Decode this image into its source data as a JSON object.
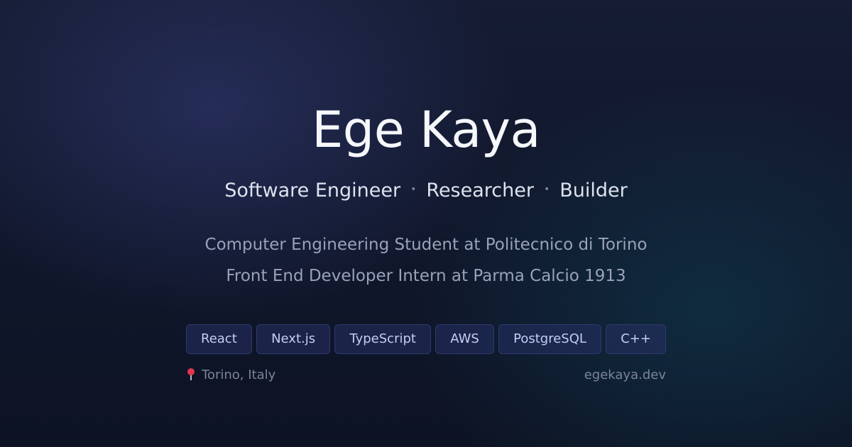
{
  "profile": {
    "name": "Ege Kaya",
    "roles": [
      "Software Engineer",
      "Researcher",
      "Builder"
    ],
    "role_separator": "•",
    "bio_lines": [
      "Computer Engineering Student at Politecnico di Torino",
      "Front End Developer Intern at Parma Calcio 1913"
    ]
  },
  "tags": [
    "React",
    "Next.js",
    "TypeScript",
    "AWS",
    "PostgreSQL",
    "C++"
  ],
  "footer": {
    "location_icon": "map-pin-icon",
    "location": "Torino, Italy",
    "website": "egekaya.dev"
  },
  "colors": {
    "background": "#10172b",
    "accent_tag_text": "#c6cdf5",
    "tag_border": "#2e3a6e",
    "pin": "#e0364f"
  }
}
